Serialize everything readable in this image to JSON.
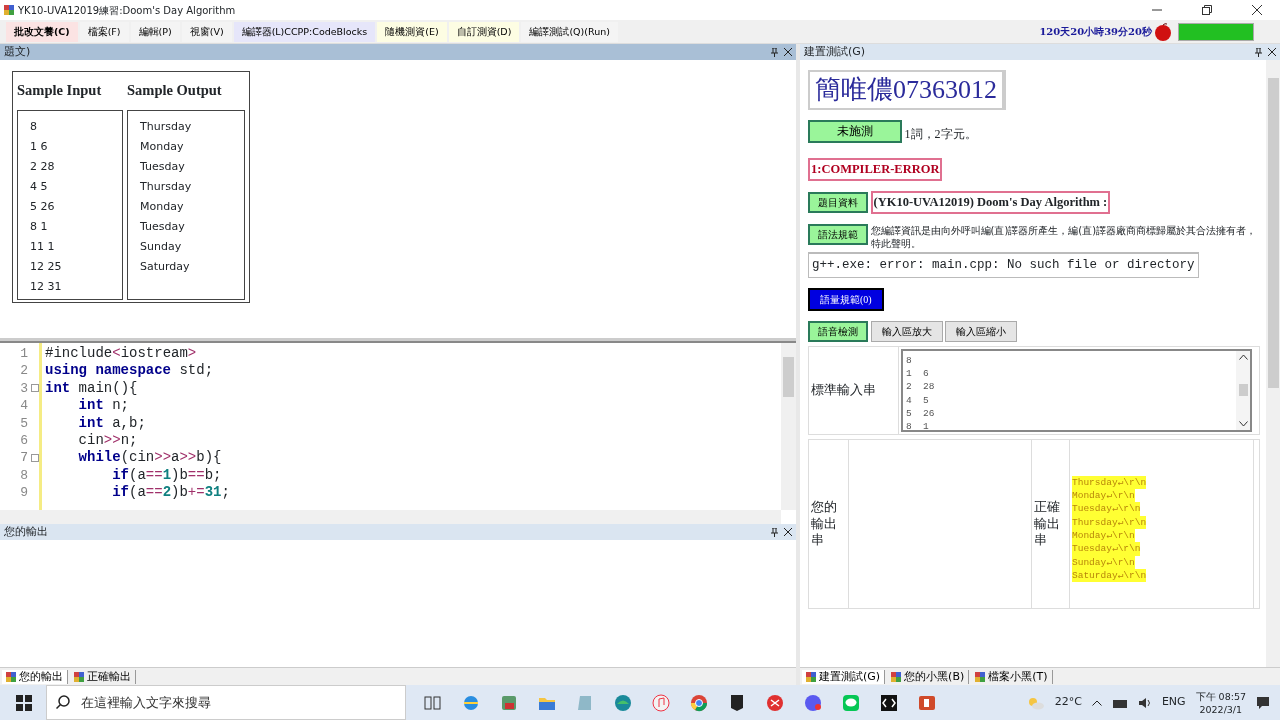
{
  "window": {
    "title": "YK10-UVA12019練習:Doom's Day Algorithm"
  },
  "menu": [
    {
      "label": "批改文養(C)",
      "color": "#fbe3e3",
      "bold": true
    },
    {
      "label": "檔案(F)",
      "color": "#f4f4f4",
      "bold": false
    },
    {
      "label": "編輯(P)",
      "color": "#f4f4f4",
      "bold": false
    },
    {
      "label": "視窗(V)",
      "color": "#f4f4f4",
      "bold": false
    },
    {
      "label": "編譯器(L)CCPP:CodeBlocks",
      "color": "#e6e6fa",
      "bold": false
    },
    {
      "label": "隨機測資(E)",
      "color": "#fdfde3",
      "bold": false
    },
    {
      "label": "自訂測資(D)",
      "color": "#fdfde3",
      "bold": false
    },
    {
      "label": "編譯測試(Q)(Run)",
      "color": "#f4f4f4",
      "bold": false
    }
  ],
  "timer": "120天20小時39分20秒",
  "timer_bar": {
    "level": 1
  },
  "problem_panel": {
    "title": "題文)",
    "input_heading": "Sample Input",
    "output_heading": "Sample Output",
    "inputs": [
      "8",
      "1 6",
      "2 28",
      "4 5",
      "5 26",
      "8 1",
      "11 1",
      "12 25",
      "12 31"
    ],
    "outputs": [
      "Thursday",
      "Monday",
      "Tuesday",
      "Thursday",
      "Monday",
      "Tuesday",
      "Sunday",
      "Saturday"
    ]
  },
  "code": [
    {
      "number": "1",
      "fold": false,
      "segments": [
        {
          "text": "#include",
          "kind": "plain"
        },
        {
          "text": "<",
          "kind": "op"
        },
        {
          "text": "iostream",
          "kind": "plain"
        },
        {
          "text": ">",
          "kind": "op"
        }
      ]
    },
    {
      "number": "2",
      "fold": false,
      "segments": [
        {
          "text": "using namespace",
          "kind": "kw"
        },
        {
          "text": " std;",
          "kind": "plain"
        }
      ]
    },
    {
      "number": "3",
      "fold": true,
      "segments": [
        {
          "text": "int",
          "kind": "kw"
        },
        {
          "text": " main(){",
          "kind": "plain"
        }
      ]
    },
    {
      "number": "4",
      "fold": false,
      "segments": [
        {
          "text": "    int",
          "kind": "kw"
        },
        {
          "text": " n;",
          "kind": "plain"
        }
      ]
    },
    {
      "number": "5",
      "fold": false,
      "segments": [
        {
          "text": "    int",
          "kind": "kw"
        },
        {
          "text": " a,b;",
          "kind": "plain"
        }
      ]
    },
    {
      "number": "6",
      "fold": false,
      "segments": [
        {
          "text": "    cin",
          "kind": "plain"
        },
        {
          "text": ">>",
          "kind": "op"
        },
        {
          "text": "n;",
          "kind": "plain"
        }
      ]
    },
    {
      "number": "7",
      "fold": true,
      "segments": [
        {
          "text": "    while",
          "kind": "kw"
        },
        {
          "text": "(cin",
          "kind": "plain"
        },
        {
          "text": ">>",
          "kind": "op"
        },
        {
          "text": "a",
          "kind": "plain"
        },
        {
          "text": ">>",
          "kind": "op"
        },
        {
          "text": "b){",
          "kind": "plain"
        }
      ]
    },
    {
      "number": "8",
      "fold": false,
      "segments": [
        {
          "text": "        if",
          "kind": "kw"
        },
        {
          "text": "(a",
          "kind": "plain"
        },
        {
          "text": "==",
          "kind": "op"
        },
        {
          "text": "1",
          "kind": "num"
        },
        {
          "text": ")b",
          "kind": "plain"
        },
        {
          "text": "==",
          "kind": "op"
        },
        {
          "text": "b;",
          "kind": "plain"
        }
      ]
    },
    {
      "number": "9",
      "fold": false,
      "segments": [
        {
          "text": "        if",
          "kind": "kw"
        },
        {
          "text": "(a",
          "kind": "plain"
        },
        {
          "text": "==",
          "kind": "op"
        },
        {
          "text": "2",
          "kind": "num"
        },
        {
          "text": ")b",
          "kind": "plain"
        },
        {
          "text": "+=",
          "kind": "op"
        },
        {
          "text": "31",
          "kind": "num"
        },
        {
          "text": ";",
          "kind": "plain"
        }
      ]
    }
  ],
  "output_panel": {
    "title": "您的輸出"
  },
  "left_tabs": [
    {
      "label": "您的輸出",
      "selected": true
    },
    {
      "label": "正確輸出",
      "selected": false
    }
  ],
  "build_panel": {
    "title": "建置測試(G)",
    "student": "簡唯儂07363012",
    "status_button": "未施測",
    "word_count": "1詞，2字元。",
    "result": "1:COMPILER-ERROR",
    "problem_button": "題目資料",
    "problem_title": "(YK10-UVA12019) Doom's Day Algorithm :",
    "syntax_button": "語法規範",
    "notice": "您編譯資訊是由向外呼叫編(直)譯器所產生，編(直)譯器廠商商標歸屬於其合法擁有者，特此聲明。",
    "error": "g++.exe: error: main.cpp: No such file or directory",
    "volume_button": "語量規範(0)",
    "buttons": [
      {
        "label": "語音檢測",
        "kind": "green"
      },
      {
        "label": "輸入區放大",
        "kind": "gray"
      },
      {
        "label": "輸入區縮小",
        "kind": "gray"
      }
    ],
    "input_label": "標準輸入串",
    "input_lines": [
      "8",
      "1  6",
      "2  28",
      "4  5",
      "5  26",
      "8  1"
    ],
    "your_output_label": "您的輸出串",
    "correct_output_label": "正確輸出串",
    "correct_lines": [
      "Thursday↵\\r\\n",
      "Monday↵\\r\\n",
      "Tuesday↵\\r\\n",
      "Thursday↵\\r\\n",
      "Monday↵\\r\\n",
      "Tuesday↵\\r\\n",
      "Sunday↵\\r\\n",
      "Saturday↵\\r\\n"
    ]
  },
  "right_tabs": [
    {
      "label": "建置測試(G)",
      "selected": true
    },
    {
      "label": "您的小黑(B)",
      "selected": false
    },
    {
      "label": "檔案小黑(T)",
      "selected": false
    }
  ],
  "taskbar": {
    "search_placeholder": "在這裡輸入文字來搜尋",
    "temperature": "22°C",
    "language": "ENG",
    "time": "下午 08:57",
    "date": "2022/3/1"
  }
}
